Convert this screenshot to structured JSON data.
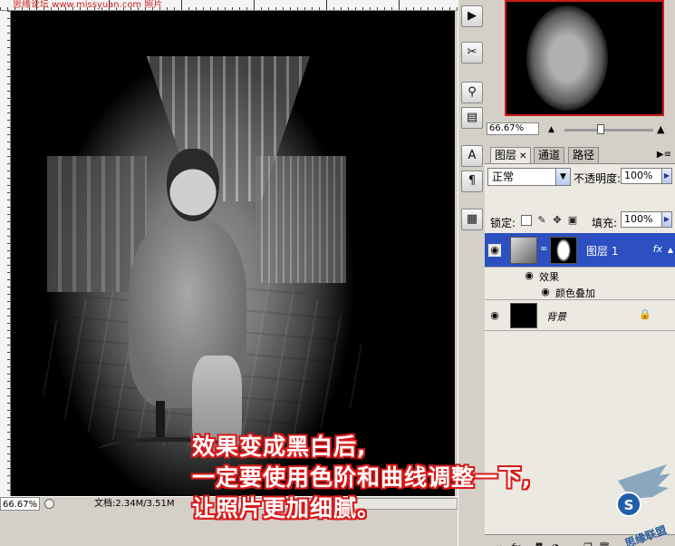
{
  "watermark_top": "思缘论坛 www.missyuan.com 照片",
  "status": {
    "zoom": "66.67%",
    "document": "文档:2.34M/3.51M"
  },
  "caption": {
    "line1": "效果变成黑白后,",
    "line2": "一定要使用色阶和曲线调整一下,",
    "line3": "让照片更加细腻。"
  },
  "navigator": {
    "zoom": "66.67%"
  },
  "layers_panel": {
    "tabs": [
      "图层",
      "通道",
      "路径"
    ],
    "blend_mode": "正常",
    "opacity_label": "不透明度:",
    "opacity_value": "100%",
    "lock_label": "锁定:",
    "fill_label": "填充:",
    "fill_value": "100%",
    "layers": [
      {
        "name": "图层 1",
        "selected": true,
        "fx": "fx"
      },
      {
        "name": "效果"
      },
      {
        "name": "颜色叠加"
      },
      {
        "name": "背景",
        "locked": true
      }
    ]
  },
  "logo_text": "思缘联盟"
}
